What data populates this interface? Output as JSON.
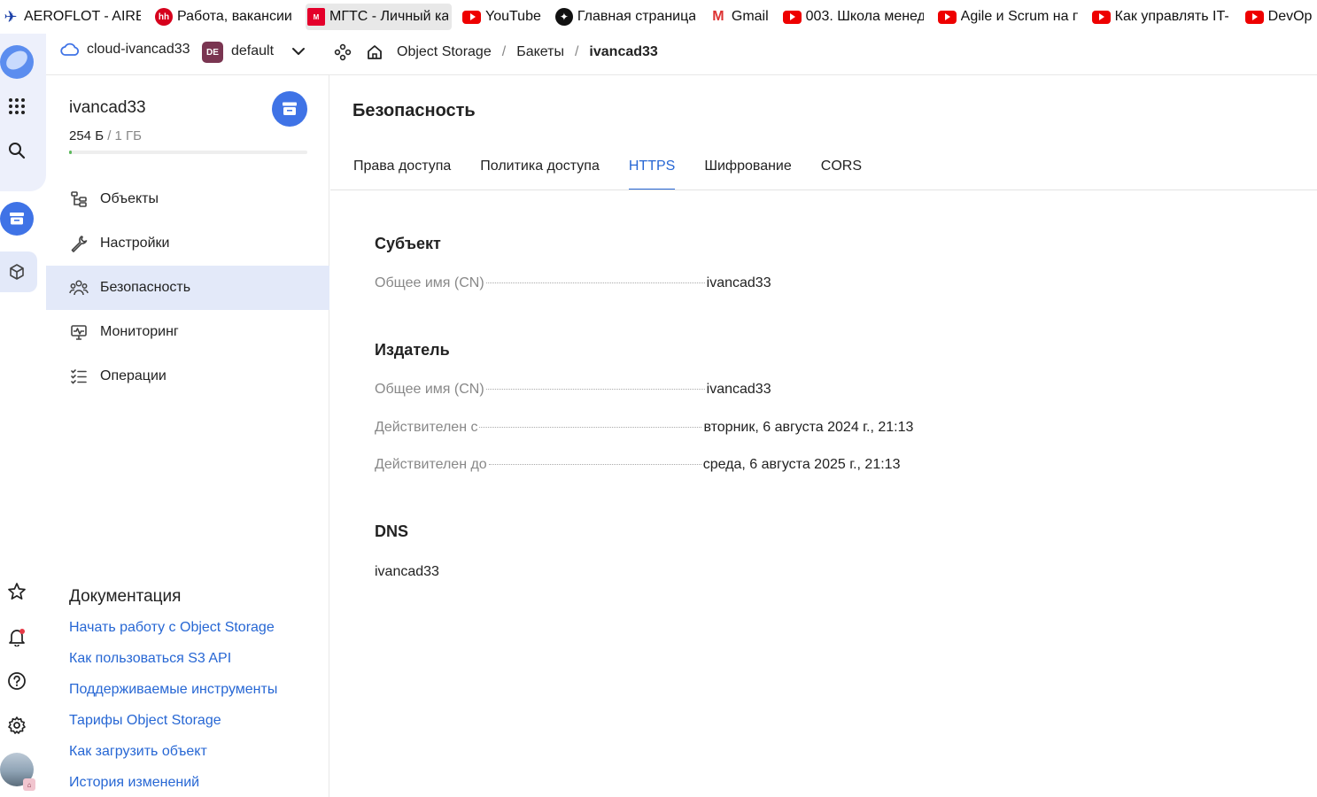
{
  "bookmarks": [
    {
      "label": "AEROFLOT - AIRB",
      "icon": "aeroflot-icon"
    },
    {
      "label": "Работа, вакансии",
      "icon": "hh-icon"
    },
    {
      "label": "МГТС - Личный ка",
      "icon": "mgts-icon"
    },
    {
      "label": "YouTube",
      "icon": "youtube-icon"
    },
    {
      "label": "Главная страница",
      "icon": "sparkle-icon"
    },
    {
      "label": "Gmail",
      "icon": "gmail-icon"
    },
    {
      "label": "003. Школа менед",
      "icon": "youtube-icon"
    },
    {
      "label": "Agile и Scrum на п",
      "icon": "youtube-icon"
    },
    {
      "label": "Как управлять IT-",
      "icon": "youtube-icon"
    },
    {
      "label": "DevOp",
      "icon": "youtube-icon"
    }
  ],
  "header": {
    "cloud_name": "cloud-ivancad33",
    "folder_badge": "DE",
    "folder_name": "default",
    "breadcrumbs": [
      "Object Storage",
      "Бакеты",
      "ivancad33"
    ]
  },
  "sidebar": {
    "bucket_name": "ivancad33",
    "size_used": "254 Б",
    "size_limit": " / 1 ГБ",
    "usage_fraction": 0.01,
    "items": [
      {
        "label": "Объекты",
        "icon": "objects-icon"
      },
      {
        "label": "Настройки",
        "icon": "wrench-icon"
      },
      {
        "label": "Безопасность",
        "icon": "users-icon"
      },
      {
        "label": "Мониторинг",
        "icon": "monitor-icon"
      },
      {
        "label": "Операции",
        "icon": "list-icon"
      }
    ],
    "docs_title": "Документация",
    "docs_links": [
      "Начать работу с Object Storage",
      "Как пользоваться S3 API",
      "Поддерживаемые инструменты",
      "Тарифы Object Storage",
      "Как загрузить объект",
      "История изменений"
    ]
  },
  "main": {
    "title": "Безопасность",
    "tabs": [
      "Права доступа",
      "Политика доступа",
      "HTTPS",
      "Шифрование",
      "CORS"
    ],
    "subject": {
      "heading": "Субъект",
      "cn_label": "Общее имя (CN)",
      "cn_value": "ivancad33"
    },
    "issuer": {
      "heading": "Издатель",
      "cn_label": "Общее имя (CN)",
      "cn_value": "ivancad33",
      "valid_from_label": "Действителен с",
      "valid_from_value": "вторник, 6 августа 2024 г., 21:13",
      "valid_to_label": "Действителен до",
      "valid_to_value": "среда, 6 августа 2025 г., 21:13"
    },
    "dns": {
      "heading": "DNS",
      "value": "ivancad33"
    }
  },
  "colors": {
    "accent": "#2767d4",
    "rail_active": "#3f73e6",
    "selected_bg": "#e3e9f9",
    "usage_fill": "#5cb85c"
  }
}
